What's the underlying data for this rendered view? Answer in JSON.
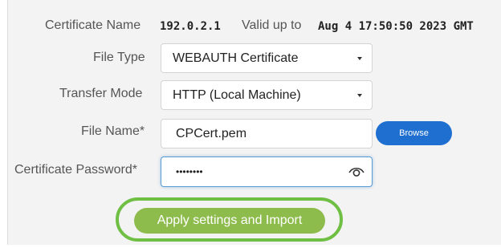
{
  "certificate_info": {
    "name_label": "Certificate Name",
    "name_value": "192.0.2.1",
    "valid_label": "Valid up to",
    "valid_value": "Aug 4 17:50:50 2023 GMT"
  },
  "form": {
    "file_type": {
      "label": "File Type",
      "value": "WEBAUTH Certificate"
    },
    "transfer_mode": {
      "label": "Transfer Mode",
      "value": "HTTP (Local Machine)"
    },
    "file_name": {
      "label": "File Name*",
      "value": "CPCert.pem",
      "browse_label": "Browse"
    },
    "certificate_password": {
      "label": "Certificate Password*",
      "value": "••••••••"
    }
  },
  "actions": {
    "apply_label": "Apply settings and Import"
  },
  "icons": {
    "password_toggle": "eye-icon",
    "dropdown": "chevron-down-icon"
  },
  "colors": {
    "browse_button": "#1e6fd0",
    "apply_button": "#8dbb4c",
    "highlight_ring": "#6fbf44"
  }
}
